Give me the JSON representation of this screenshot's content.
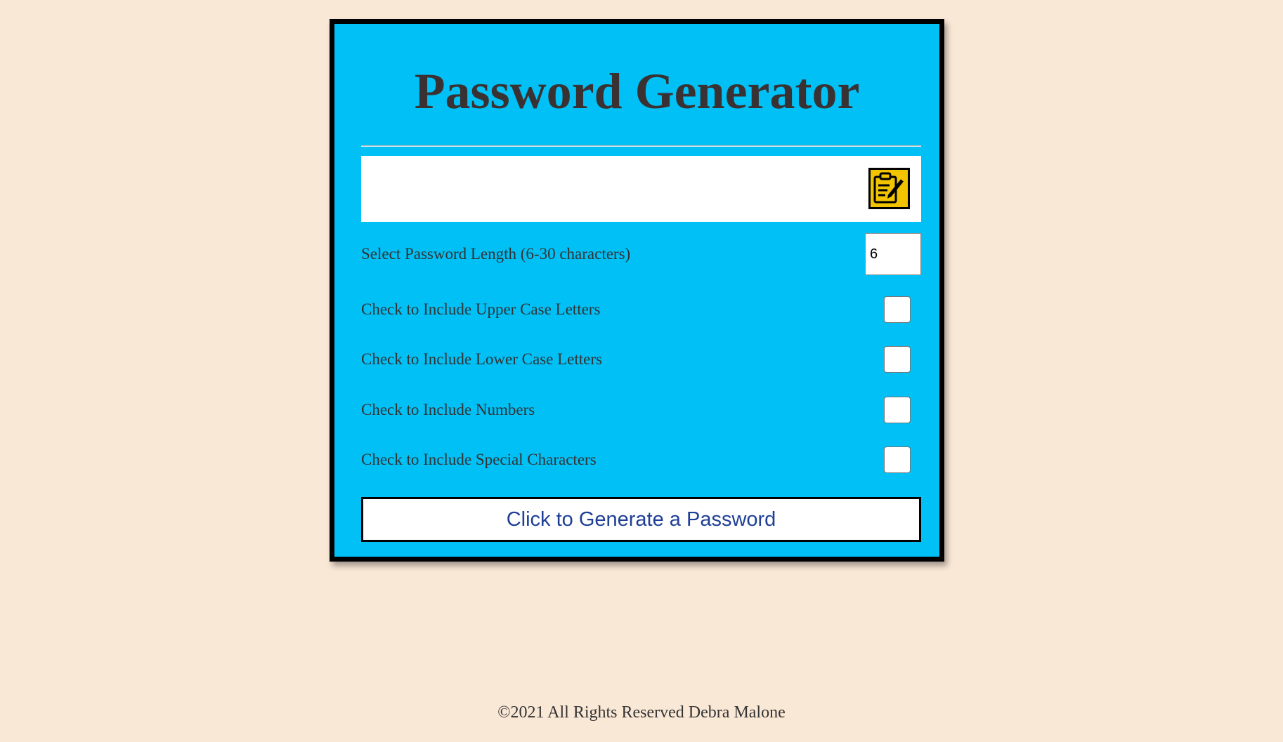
{
  "app": {
    "title": "Password Generator"
  },
  "output": {
    "value": "",
    "copy_icon": "clipboard-edit-icon"
  },
  "length": {
    "label": "Select Password Length (6-30 characters)",
    "value": "6"
  },
  "options": [
    {
      "label": "Check to Include Upper Case Letters",
      "checked": false
    },
    {
      "label": "Check to Include Lower Case Letters",
      "checked": false
    },
    {
      "label": "Check to Include Numbers",
      "checked": false
    },
    {
      "label": "Check to Include Special Characters",
      "checked": false
    }
  ],
  "generate_button": {
    "label": "Click to Generate a Password"
  },
  "footer": {
    "text": "©2021 All Rights Reserved Debra Malone"
  },
  "colors": {
    "page_background": "#fae8d6",
    "card_background": "#00c0f6",
    "copy_button": "#f2c400",
    "button_text": "#1f3f96"
  }
}
